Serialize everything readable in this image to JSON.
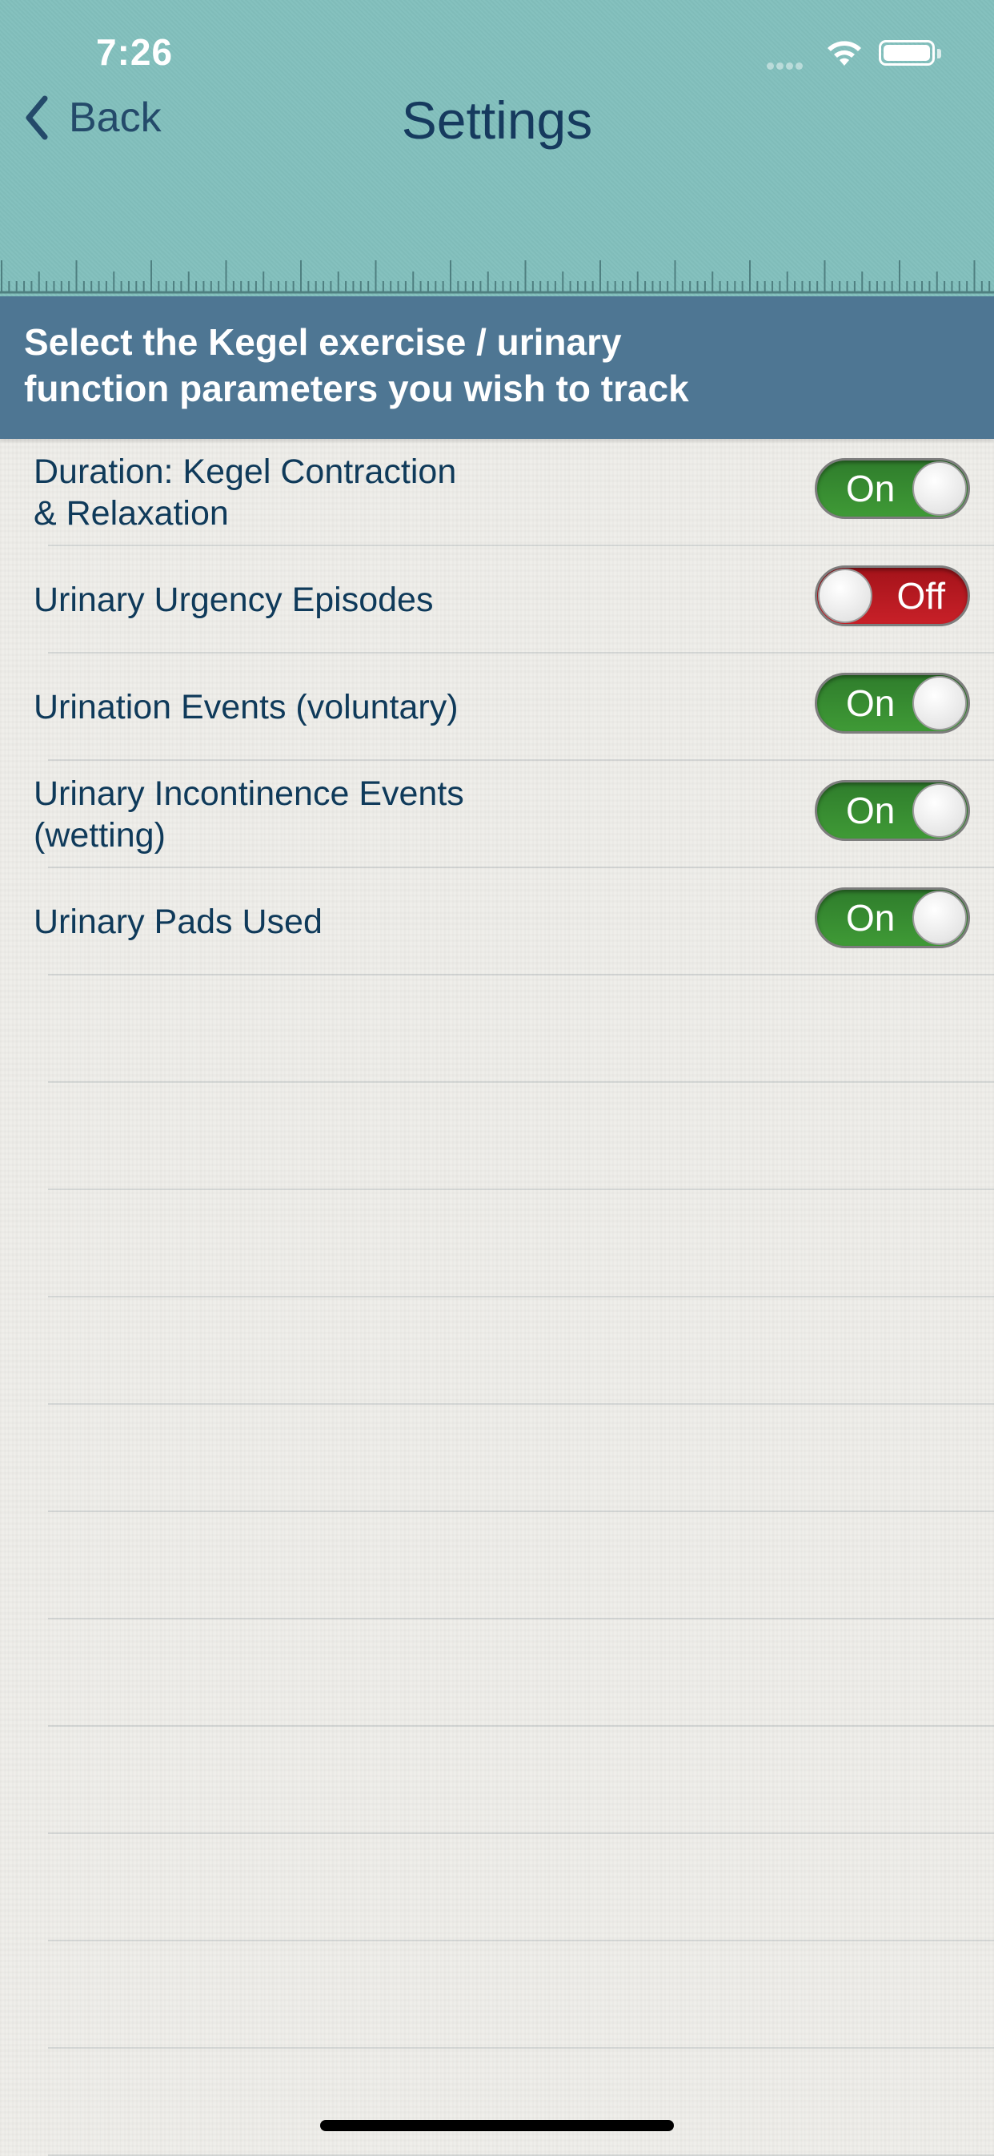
{
  "status_bar": {
    "time": "7:26"
  },
  "nav": {
    "back_label": "Back",
    "title": "Settings"
  },
  "banner": {
    "line1": "Select the Kegel exercise / urinary",
    "line2": "function parameters you wish to track"
  },
  "settings": [
    {
      "label_line1": "Duration: Kegel Contraction",
      "label_line2": "& Relaxation",
      "state": "On"
    },
    {
      "label_line1": "Urinary Urgency Episodes",
      "label_line2": "",
      "state": "Off"
    },
    {
      "label_line1": "Urination Events (voluntary)",
      "label_line2": "",
      "state": "On"
    },
    {
      "label_line1": "Urinary Incontinence Events",
      "label_line2": "(wetting)",
      "state": "On"
    },
    {
      "label_line1": "Urinary Pads Used",
      "label_line2": "",
      "state": "On"
    }
  ],
  "colors": {
    "header_teal": "#82c0bd",
    "banner_blue": "#4e7693",
    "toggle_on": "#3a8c33",
    "toggle_off": "#b81a22",
    "text_navy": "#0f3a5a"
  },
  "icons": [
    "back-chevron-icon",
    "wifi-icon",
    "battery-icon",
    "ruler-ticks"
  ]
}
